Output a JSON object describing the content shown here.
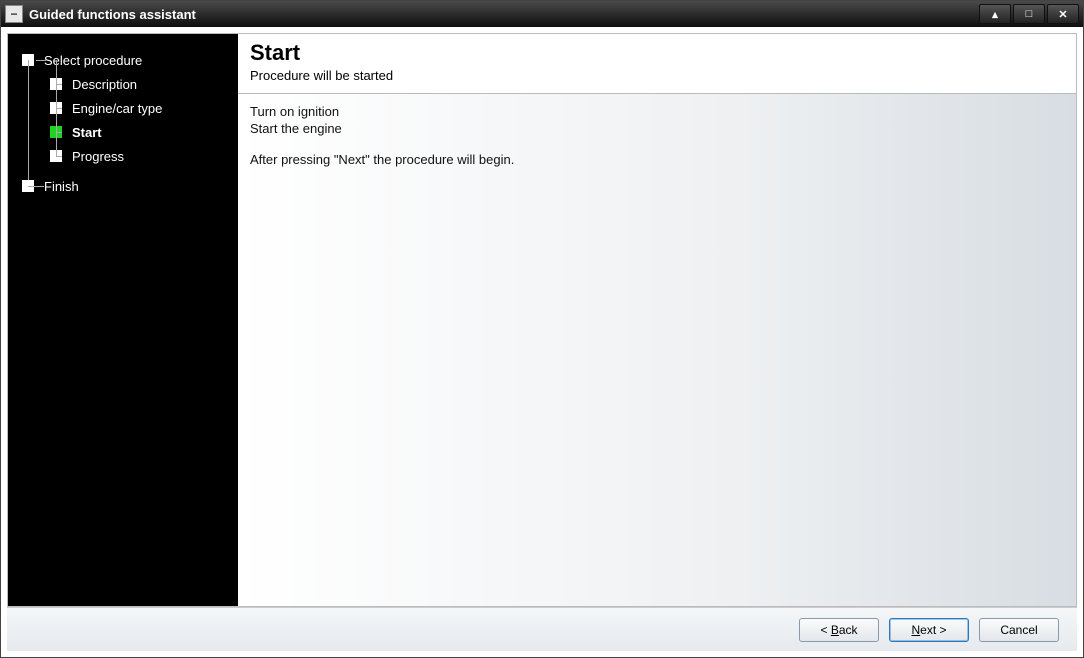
{
  "window": {
    "title": "Guided functions assistant",
    "min_label": "▴",
    "max_label": "□",
    "close_label": "✕"
  },
  "sidebar": {
    "steps": [
      {
        "label": "Select procedure",
        "level": 1,
        "active": false
      },
      {
        "label": "Description",
        "level": 2,
        "active": false
      },
      {
        "label": "Engine/car type",
        "level": 2,
        "active": false
      },
      {
        "label": "Start",
        "level": 2,
        "active": true
      },
      {
        "label": "Progress",
        "level": 2,
        "active": false
      },
      {
        "label": "Finish",
        "level": 1,
        "active": false
      }
    ]
  },
  "content": {
    "title": "Start",
    "subtitle": "Procedure will be started",
    "body_lines": [
      "Turn on ignition",
      "Start the engine",
      "",
      "After pressing \"Next\" the procedure will begin."
    ]
  },
  "footer": {
    "back_prefix": "< ",
    "back_accel": "B",
    "back_suffix": "ack",
    "next_accel": "N",
    "next_suffix": "ext >",
    "cancel": "Cancel"
  }
}
